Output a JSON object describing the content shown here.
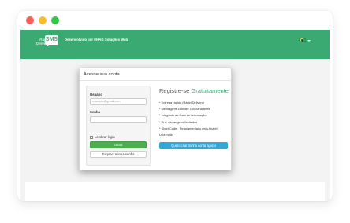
{
  "navbar": {
    "logo_line1": "Rapid",
    "logo_line2": "Delivery",
    "logo_badge": "SMS",
    "developer_text": "Desenvolvido por EHAG Soluções Web"
  },
  "modal": {
    "title": "Acesse sua conta",
    "login": {
      "user_label": "Usuário",
      "user_placeholder": "example@gmail.com",
      "password_label": "Senha",
      "password_value": "",
      "remember_label": "Lembrar login",
      "enter_button": "Entrar",
      "forgot_button": "Esqueci minha senha"
    },
    "register": {
      "title_prefix": "Registre-se",
      "title_free": "Gratuitamente",
      "features": [
        "* Entrega rápida (Rapid Delivery)",
        "* Mensagens com até 160 caracteres",
        "* Integrado ao fluxo de automação",
        "* Crie mensagens ilimitadas",
        "* Short Code - Regulamentado pela Anatel"
      ],
      "read_more": "Leia mais",
      "signup_button": "Quero criar minha conta agora!"
    }
  },
  "colors": {
    "navbar": "#3aaa72",
    "enter_button": "#4cae4c",
    "signup_button": "#31a8d8"
  },
  "icons": {
    "language_flag": "brazil-flag-icon",
    "language_caret": "caret-down-icon"
  }
}
